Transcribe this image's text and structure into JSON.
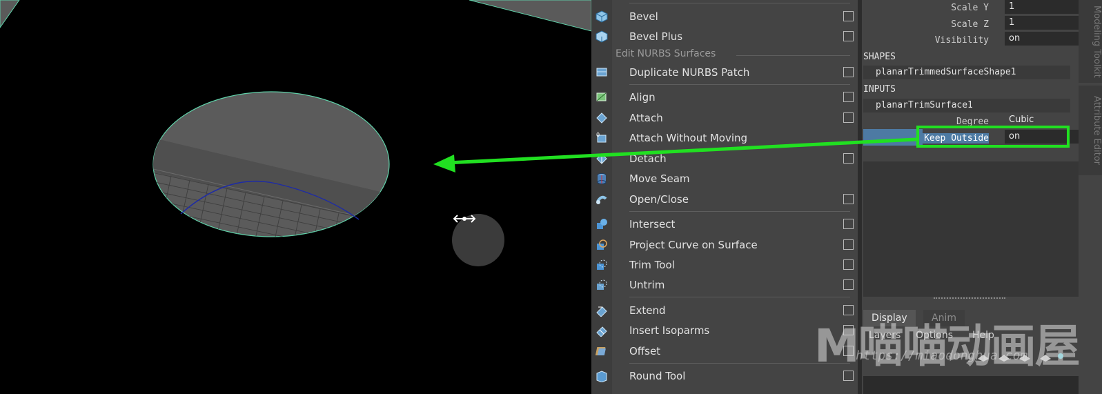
{
  "menu": {
    "items": [
      {
        "label": "Bevel",
        "icon": "bevel-icon",
        "option_box": true
      },
      {
        "label": "Bevel Plus",
        "icon": "bevel-plus-icon",
        "option_box": true
      },
      {
        "label": "Duplicate NURBS Patch",
        "icon": "duplicate-nurbs-patch-icon",
        "option_box": true
      },
      {
        "label": "Align",
        "icon": "align-icon",
        "option_box": true
      },
      {
        "label": "Attach",
        "icon": "attach-icon",
        "option_box": true
      },
      {
        "label": "Attach Without Moving",
        "icon": "attach-without-moving-icon",
        "option_box": false
      },
      {
        "label": "Detach",
        "icon": "detach-icon",
        "option_box": true
      },
      {
        "label": "Move Seam",
        "icon": "move-seam-icon",
        "option_box": false
      },
      {
        "label": "Open/Close",
        "icon": "open-close-icon",
        "option_box": true
      },
      {
        "label": "Intersect",
        "icon": "intersect-icon",
        "option_box": true
      },
      {
        "label": "Project Curve on Surface",
        "icon": "project-curve-icon",
        "option_box": true
      },
      {
        "label": "Trim Tool",
        "icon": "trim-tool-icon",
        "option_box": true
      },
      {
        "label": "Untrim",
        "icon": "untrim-icon",
        "option_box": true
      },
      {
        "label": "Extend",
        "icon": "extend-icon",
        "option_box": true
      },
      {
        "label": "Insert Isoparms",
        "icon": "insert-isoparms-icon",
        "option_box": true
      },
      {
        "label": "Offset",
        "icon": "offset-icon",
        "option_box": true
      },
      {
        "label": "Round Tool",
        "icon": "round-tool-icon",
        "option_box": true
      }
    ],
    "section_title": "Edit NURBS Surfaces"
  },
  "channel_box": {
    "attrs_top": [
      {
        "name": "Scale Y",
        "value": "1"
      },
      {
        "name": "Scale Z",
        "value": "1"
      },
      {
        "name": "Visibility",
        "value": "on"
      }
    ],
    "shapes_header": "SHAPES",
    "shape_node": "planarTrimmedSurfaceShape1",
    "inputs_header": "INPUTS",
    "input_node": "planarTrimSurface1",
    "attrs_input": [
      {
        "name": "Degree",
        "value": "Cubic"
      },
      {
        "name": "Keep Outside",
        "value": "on"
      }
    ]
  },
  "layer_editor": {
    "tabs": [
      "Display",
      "Anim"
    ],
    "menu": [
      "Layers",
      "Options",
      "Help"
    ]
  },
  "side_tabs": [
    "Modeling Toolkit",
    "Attribute Editor"
  ],
  "watermark": {
    "brand": "M喵喵动画屋",
    "url": "https://miaodonghua.com"
  },
  "colors": {
    "highlight": "#21e021",
    "selection": "#4d7aa3",
    "surface_edge": "#5fd0a8"
  }
}
